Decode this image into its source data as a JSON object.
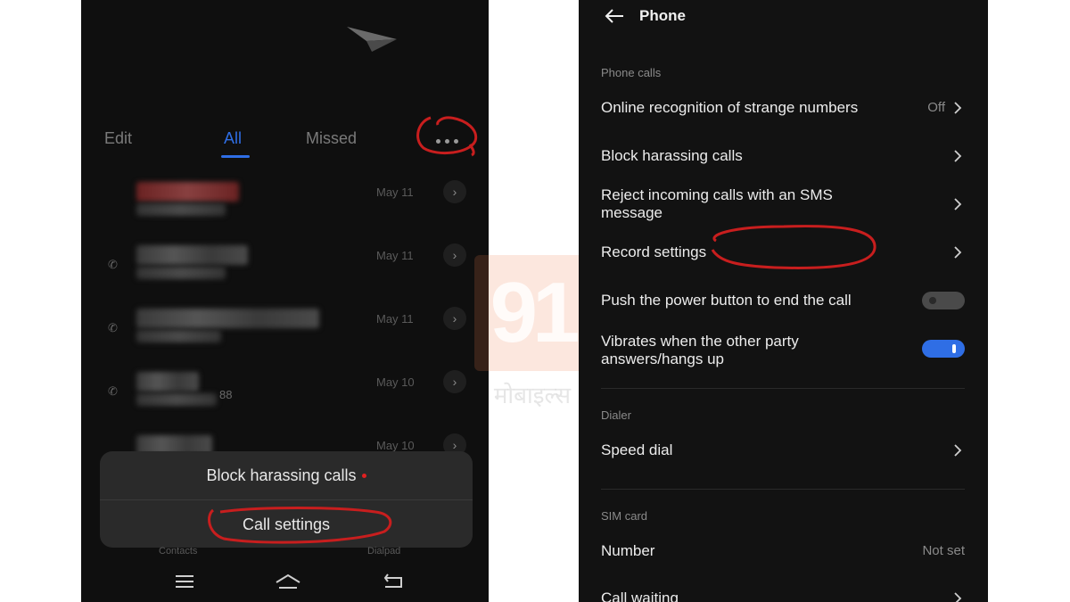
{
  "left_phone": {
    "tabs": {
      "edit": "Edit",
      "all": "All",
      "missed": "Missed"
    },
    "calls": [
      {
        "date": "May 11"
      },
      {
        "date": "May 11"
      },
      {
        "date": "May 11"
      },
      {
        "date": "May 10",
        "number_suffix": "88"
      },
      {
        "date": "May 10"
      }
    ],
    "popup": {
      "block_label": "Block harassing calls",
      "settings_label": "Call settings"
    },
    "bottom_labels": {
      "contacts": "Contacts",
      "dialpad": "Dialpad"
    }
  },
  "right_phone": {
    "title": "Phone",
    "sections": {
      "phone_calls": "Phone calls",
      "dialer": "Dialer",
      "sim_card": "SIM card"
    },
    "settings": {
      "online_recognition": {
        "label": "Online recognition of strange numbers",
        "value": "Off"
      },
      "block_harassing": {
        "label": "Block harassing calls"
      },
      "reject_sms": {
        "label": "Reject incoming calls with an SMS message"
      },
      "record_settings": {
        "label": "Record settings"
      },
      "power_button": {
        "label": "Push the power button to end the call",
        "enabled": false
      },
      "vibrates": {
        "label": "Vibrates when the other party answers/hangs up",
        "enabled": true
      },
      "speed_dial": {
        "label": "Speed dial"
      },
      "number": {
        "label": "Number",
        "value": "Not set"
      },
      "call_waiting": {
        "label": "Call waiting"
      }
    }
  },
  "watermark": {
    "logo_text": "91",
    "sub_text": "मोबाइल्स"
  },
  "colors": {
    "accent": "#2f6ee5",
    "annotation": "#c81e1e",
    "background": "#121212"
  }
}
